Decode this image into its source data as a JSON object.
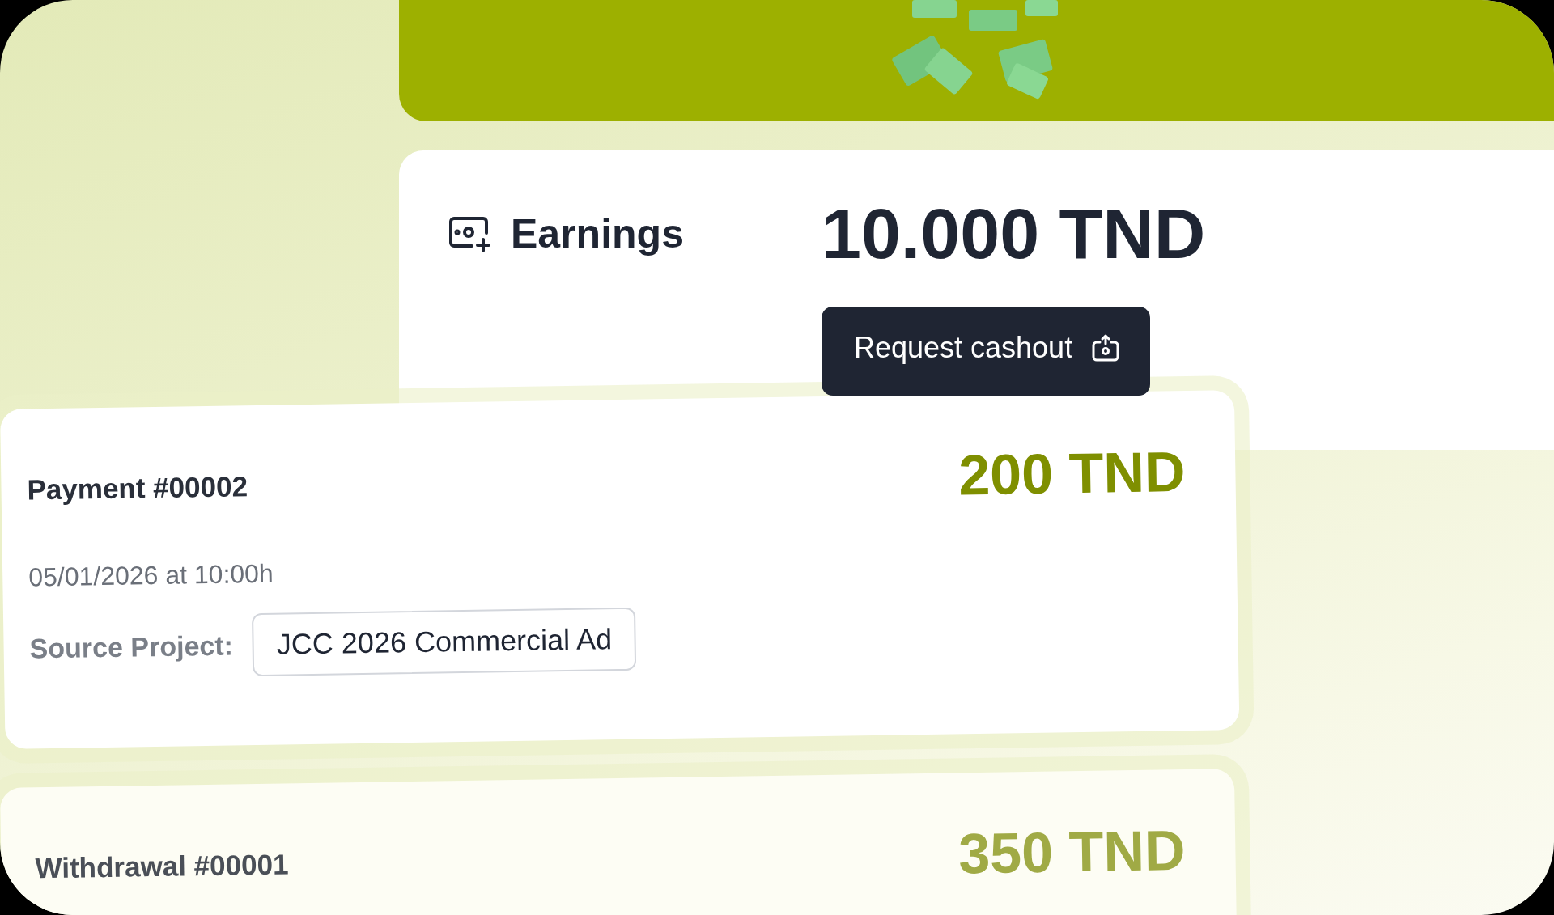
{
  "earnings": {
    "label": "Earnings",
    "amount": "10.000 TND",
    "button": "Request cashout"
  },
  "transactions": [
    {
      "kind": "payment",
      "title": "Payment #00002",
      "amount": "200 TND",
      "date": "05/01/2026 at 10:00h",
      "source_label": "Source Project:",
      "source": "JCC 2026 Commercial Ad"
    },
    {
      "kind": "withdrawal",
      "title": "Withdrawal #00001",
      "amount": "350 TND"
    }
  ]
}
